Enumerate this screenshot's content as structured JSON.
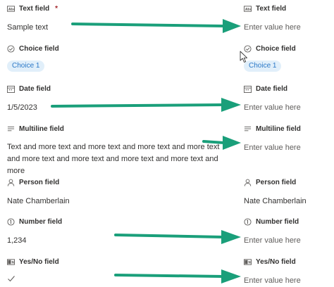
{
  "left": {
    "text": {
      "label": "Text field",
      "required_mark": "*",
      "value": "Sample text"
    },
    "choice": {
      "label": "Choice field",
      "value": "Choice 1"
    },
    "date": {
      "label": "Date field",
      "value": "1/5/2023"
    },
    "multiline": {
      "label": "Multiline field",
      "value": "Text and more text and more text and more text and more text and more text and more text and more text and more text and more"
    },
    "person": {
      "label": "Person field",
      "value": "Nate Chamberlain"
    },
    "number": {
      "label": "Number field",
      "value": "1,234"
    },
    "yesno": {
      "label": "Yes/No field",
      "value_icon": "check-icon"
    }
  },
  "right": {
    "text": {
      "label": "Text field",
      "placeholder": "Enter value here"
    },
    "choice": {
      "label": "Choice field",
      "value": "Choice 1"
    },
    "date": {
      "label": "Date field",
      "placeholder": "Enter value here"
    },
    "multiline": {
      "label": "Multiline field",
      "placeholder": "Enter value here"
    },
    "person": {
      "label": "Person field",
      "value": "Nate Chamberlain"
    },
    "number": {
      "label": "Number field",
      "placeholder": "Enter value here"
    },
    "yesno": {
      "label": "Yes/No field",
      "placeholder": "Enter value here"
    }
  },
  "icons": [
    "text-field-icon",
    "choice-field-icon",
    "date-field-icon",
    "multiline-field-icon",
    "person-field-icon",
    "number-field-icon",
    "yesno-field-icon"
  ],
  "colors": {
    "arrow": "#1a9f7a",
    "pill_bg": "#e1effa",
    "pill_text": "#2b78c7",
    "required": "#a4262c"
  }
}
